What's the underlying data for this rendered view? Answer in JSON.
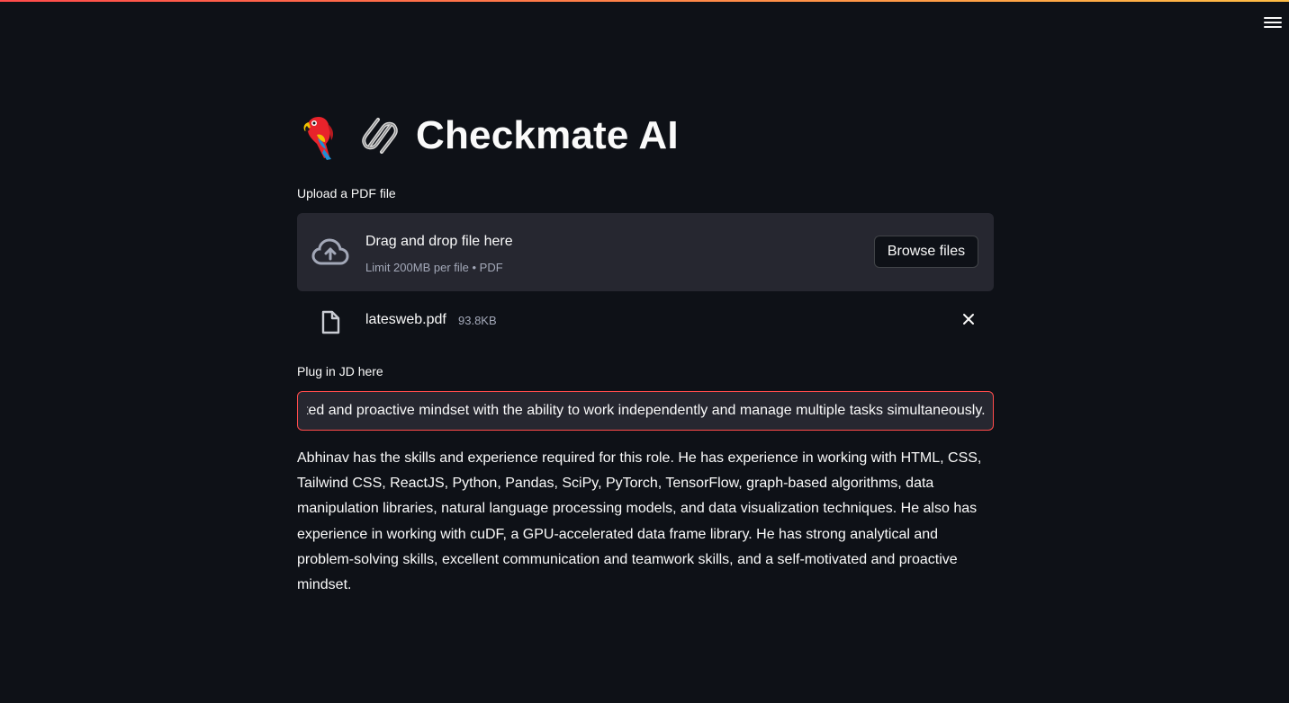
{
  "app": {
    "title": "Checkmate AI",
    "accent_color": "#ff4b4b",
    "background_color": "#0e1117",
    "title_icons": [
      "parrot-emoji-icon",
      "link-emoji-icon"
    ]
  },
  "header": {
    "menu_icon": "hamburger-menu-icon"
  },
  "uploader": {
    "label": "Upload a PDF file",
    "drop_text": "Drag and drop file here",
    "limit_text": "Limit 200MB per file • PDF",
    "browse_label": "Browse files",
    "icon": "cloud-upload-icon"
  },
  "uploaded_file": {
    "name": "latesweb.pdf",
    "size": "93.8KB",
    "icon": "file-icon",
    "remove_icon": "close-icon"
  },
  "jd_input": {
    "label": "Plug in JD here",
    "value": "Self-motivated and proactive mindset with the ability to work independently and manage multiple tasks simultaneously."
  },
  "result": {
    "text": "Abhinav has the skills and experience required for this role. He has experience in working with HTML, CSS, Tailwind CSS, ReactJS, Python, Pandas, SciPy, PyTorch, TensorFlow, graph-based algorithms, data manipulation libraries, natural language processing models, and data visualization techniques. He also has experience in working with cuDF, a GPU-accelerated data frame library. He has strong analytical and problem-solving skills, excellent communication and teamwork skills, and a self-motivated and proactive mindset."
  }
}
